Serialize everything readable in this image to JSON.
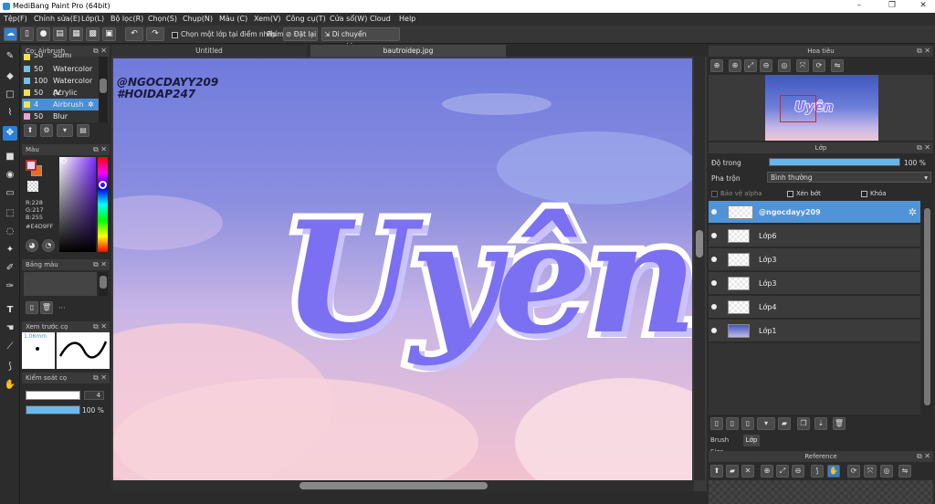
{
  "window": {
    "title": "MediBang Paint Pro (64bit)"
  },
  "menu": [
    "Tệp(F)",
    "Chỉnh sửa(E)",
    "Lớp(L)",
    "Bộ lọc(R)",
    "Chọn(S)",
    "Chụp(N)",
    "Màu (C)",
    "Xem(V)",
    "Công cụ(T)",
    "Cửa sổ(W)",
    "Cloud",
    "Help"
  ],
  "toolbar": {
    "select_one_layer": "Chọn một lớp tại điểm nhấp",
    "phim_label": "Phím",
    "reset_label": "Đặt lại",
    "move_label": "Di chuyển ngang/dọc"
  },
  "brush_panel": {
    "title": "Cọ: Airbrush",
    "items": [
      {
        "size": "50",
        "name": "Sumi",
        "color": "#f0e44a"
      },
      {
        "size": "50",
        "name": "Watercolor",
        "color": "#6ec3ee"
      },
      {
        "size": "100",
        "name": "Watercolor (V",
        "color": "#6ec3ee"
      },
      {
        "size": "50",
        "name": "Acrylic",
        "color": "#f0e44a"
      },
      {
        "size": "4",
        "name": "Airbrush",
        "color": "#f0e44a"
      },
      {
        "size": "50",
        "name": "Blur",
        "color": "#f0a0d8"
      }
    ]
  },
  "color_panel": {
    "title": "Màu",
    "r": "R:228",
    "g": "G:217",
    "b": "B:255",
    "hex": "#E4D9FF",
    "fg_color": "#e4d9ff",
    "bg_color": "#f06a1a"
  },
  "palette_panel": {
    "title": "Bảng màu",
    "more": "···"
  },
  "preview_panel": {
    "title": "Xem trước cọ",
    "size": "1.06mm"
  },
  "control_panel": {
    "title": "Kiểm soát cọ",
    "size_value": "4",
    "opacity_value": "100 %",
    "size_fraction": 0.9,
    "opacity_fraction": 1.0
  },
  "canvas_tabs": [
    "Untitled",
    "bautroidep.jpg"
  ],
  "canvas": {
    "watermark_line1": "@NGOCDAYY209",
    "watermark_line2": "#HOIDAP247",
    "art_text": "Uyên"
  },
  "navigator": {
    "title": "Hoa tiêu",
    "thumb_text": "Uyên"
  },
  "layer_panel": {
    "title": "Lớp",
    "opacity_label": "Độ trong",
    "opacity_value": "100 %",
    "opacity_fraction": 1.0,
    "blend_label": "Pha trộn",
    "blend_value": "Bình thường",
    "protect_alpha": "Bảo vệ alpha",
    "clipping": "Xén bớt",
    "lock": "Khóa",
    "layers": [
      {
        "name": "@ngocdayy209",
        "selected": true
      },
      {
        "name": "Lớp6",
        "selected": false
      },
      {
        "name": "Lớp3",
        "selected": false
      },
      {
        "name": "Lớp3",
        "selected": false
      },
      {
        "name": "Lớp4",
        "selected": false
      },
      {
        "name": "Lớp1",
        "selected": false
      }
    ]
  },
  "bottom_tabs": [
    "Brush Size",
    "Lớp"
  ],
  "reference_panel": {
    "title": "Reference"
  },
  "colors": {
    "accent": "#4f94d6",
    "panel": "#2b2b2b",
    "header": "#3a3a3a"
  }
}
